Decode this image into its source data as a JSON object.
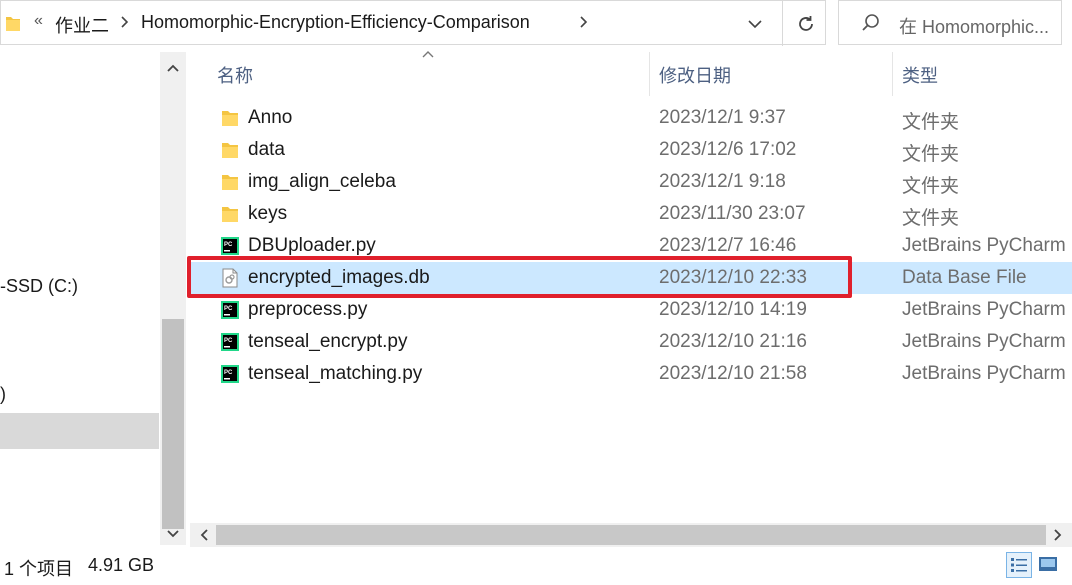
{
  "address": {
    "overflow_chevron": "«",
    "crumbs": [
      "作业二",
      "Homomorphic-Encryption-Efficiency-Comparison"
    ]
  },
  "search": {
    "placeholder": "在 Homomorphic..."
  },
  "nav": {
    "items": [
      {
        "label": "-SSD (C:)"
      },
      {
        "label": ")"
      }
    ]
  },
  "columns": {
    "name": "名称",
    "date": "修改日期",
    "type": "类型"
  },
  "files": [
    {
      "name": "Anno",
      "date": "2023/12/1 9:37",
      "type": "文件夹",
      "icon": "folder-icon"
    },
    {
      "name": "data",
      "date": "2023/12/6 17:02",
      "type": "文件夹",
      "icon": "folder-icon"
    },
    {
      "name": "img_align_celeba",
      "date": "2023/12/1 9:18",
      "type": "文件夹",
      "icon": "folder-icon"
    },
    {
      "name": "keys",
      "date": "2023/11/30 23:07",
      "type": "文件夹",
      "icon": "folder-icon"
    },
    {
      "name": "DBUploader.py",
      "date": "2023/12/7 16:46",
      "type": "JetBrains PyCharm ...",
      "icon": "pycharm-file-icon"
    },
    {
      "name": "encrypted_images.db",
      "date": "2023/12/10 22:33",
      "type": "Data Base File",
      "icon": "db-file-icon",
      "selected": true
    },
    {
      "name": "preprocess.py",
      "date": "2023/12/10 14:19",
      "type": "JetBrains PyCharm ...",
      "icon": "pycharm-file-icon"
    },
    {
      "name": "tenseal_encrypt.py",
      "date": "2023/12/10 21:16",
      "type": "JetBrains PyCharm ...",
      "icon": "pycharm-file-icon"
    },
    {
      "name": "tenseal_matching.py",
      "date": "2023/12/10 21:58",
      "type": "JetBrains PyCharm ...",
      "icon": "pycharm-file-icon"
    }
  ],
  "status": {
    "selection": "1 个项目",
    "size": "4.91 GB"
  },
  "colors": {
    "selection_bg": "#cce8ff",
    "highlight_border": "#e0202c",
    "header_text": "#4d6082",
    "folder_yellow": "#f4c542"
  }
}
